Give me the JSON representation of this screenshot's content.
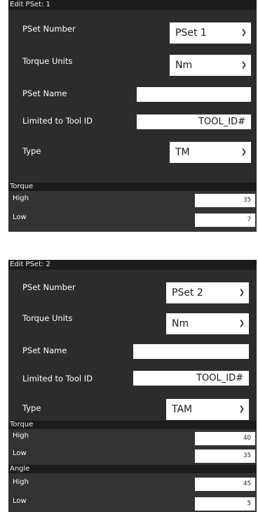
{
  "panels": [
    {
      "title": "Edit PSet: 1",
      "pset_number_label": "PSet Number",
      "pset_number_value": "PSet 1",
      "torque_units_label": "Torque Units",
      "torque_units_value": "Nm",
      "pset_name_label": "PSet Name",
      "pset_name_value": "",
      "tool_id_label": "Limited to Tool ID",
      "tool_id_value": "TOOL_ID#",
      "type_label": "Type",
      "type_value": "TM",
      "torque": {
        "header": "Torque",
        "high_label": "High",
        "high_value": "35",
        "low_label": "Low",
        "low_value": "7"
      }
    },
    {
      "title": "Edit PSet: 2",
      "pset_number_label": "PSet Number",
      "pset_number_value": "PSet 2",
      "torque_units_label": "Torque Units",
      "torque_units_value": "Nm",
      "pset_name_label": "PSet Name",
      "pset_name_value": "",
      "tool_id_label": "Limited to Tool ID",
      "tool_id_value": "TOOL_ID#",
      "type_label": "Type",
      "type_value": "TAM",
      "torque": {
        "header": "Torque",
        "high_label": "High",
        "high_value": "40",
        "low_label": "Low",
        "low_value": "35"
      },
      "angle": {
        "header": "Angle",
        "high_label": "High",
        "high_value": "45",
        "low_label": "Low",
        "low_value": "5"
      }
    }
  ],
  "icons": {
    "dropdown": "chevron-down-icon"
  }
}
